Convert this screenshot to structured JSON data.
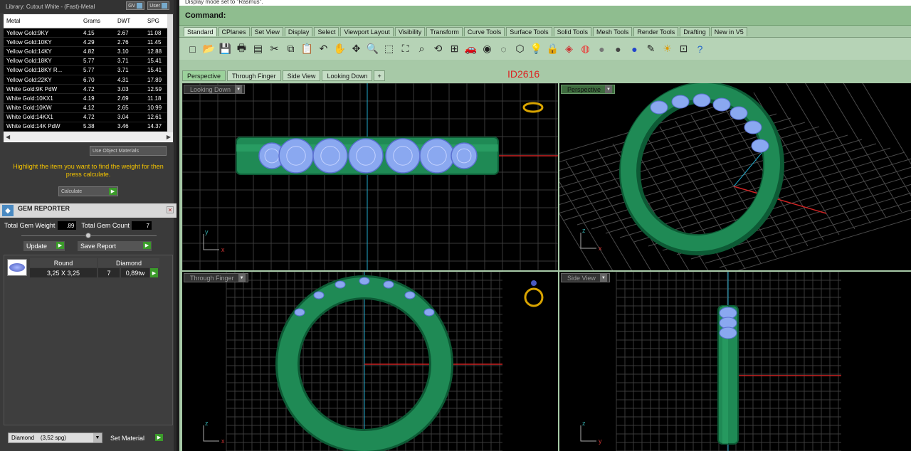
{
  "library": {
    "title": "Library: Cutout White - (Fast)-Metal",
    "gv_label": "GV",
    "user_label": "User",
    "columns": [
      "Metal",
      "Grams",
      "DWT",
      "SPG"
    ],
    "rows": [
      [
        "Yellow Gold:9KY",
        "4.15",
        "2.67",
        "11.08"
      ],
      [
        "Yellow Gold:10KY",
        "4.29",
        "2.76",
        "11.45"
      ],
      [
        "Yellow Gold:14KY",
        "4.82",
        "3.10",
        "12.88"
      ],
      [
        "Yellow Gold:18KY",
        "5.77",
        "3.71",
        "15.41"
      ],
      [
        "Yellow Gold:18KY R...",
        "5.77",
        "3.71",
        "15.41"
      ],
      [
        "Yellow Gold:22KY",
        "6.70",
        "4.31",
        "17.89"
      ],
      [
        "White Gold:9K PdW",
        "4.72",
        "3.03",
        "12.59"
      ],
      [
        "White Gold:10KX1",
        "4.19",
        "2.69",
        "11.18"
      ],
      [
        "White Gold:10KW",
        "4.12",
        "2.65",
        "10.99"
      ],
      [
        "White Gold:14KX1",
        "4.72",
        "3.04",
        "12.61"
      ],
      [
        "White Gold:14K PdW",
        "5.38",
        "3.46",
        "14.37"
      ]
    ],
    "use_object_materials": "Use Object Materials",
    "hint": "Highlight the item you want to find the weight for then press calculate.",
    "calculate": "Calculate"
  },
  "gem_reporter": {
    "title": "GEM REPORTER",
    "total_weight_label": "Total Gem Weight",
    "total_weight": ".89",
    "total_count_label": "Total Gem Count",
    "total_count": "7",
    "update": "Update",
    "save_report": "Save Report",
    "gem": {
      "shape": "Round",
      "material": "Diamond",
      "size": "3,25 X 3,25",
      "count": "7",
      "weight": "0,89tw"
    },
    "material_dropdown": "Diamond    (3,52 spg)",
    "set_material": "Set Material"
  },
  "top": {
    "status": "Display mode set to \"Rasmus\".",
    "command": "Command:"
  },
  "tabs": [
    "Standard",
    "CPlanes",
    "Set View",
    "Display",
    "Select",
    "Viewport Layout",
    "Visibility",
    "Transform",
    "Curve Tools",
    "Surface Tools",
    "Solid Tools",
    "Mesh Tools",
    "Render Tools",
    "Drafting",
    "New in V5"
  ],
  "tools": [
    "new-icon",
    "open-icon",
    "save-icon",
    "print-icon",
    "page-icon",
    "cut-icon",
    "copy-icon",
    "paste-icon",
    "undo-icon",
    "pan-icon",
    "move-icon",
    "zoom-icon",
    "zoom-window-icon",
    "zoom-extents-icon",
    "zoom-selected-icon",
    "rotate-view-icon",
    "grid-icon",
    "car-icon",
    "point-icon",
    "circle-icon",
    "select-icon",
    "light-icon",
    "lock-icon",
    "material-icon",
    "color-wheel-icon",
    "sphere-gray-icon",
    "sphere-shaded-icon",
    "sphere-blue-icon",
    "render-icon",
    "sun-icon",
    "dimension-icon",
    "help-icon"
  ],
  "tool_glyphs": [
    "□",
    "📂",
    "💾",
    "🖶",
    "▤",
    "✂",
    "⧉",
    "📋",
    "↶",
    "✋",
    "✥",
    "🔍",
    "⬚",
    "⛶",
    "⌕",
    "⟲",
    "⊞",
    "🚗",
    "◉",
    "◌",
    "⬡",
    "💡",
    "🔒",
    "◈",
    "◍",
    "●",
    "●",
    "●",
    "✎",
    "☀",
    "⊡",
    "?"
  ],
  "viewport_tabs": [
    "Perspective",
    "Through Finger",
    "Side View",
    "Looking Down"
  ],
  "id_label": "ID2616",
  "viewports": {
    "top_left": "Looking Down",
    "top_right": "Perspective",
    "bottom_left": "Through Finger",
    "bottom_right": "Side View"
  },
  "colors": {
    "ring_green": "#1f8a55",
    "gem_blue": "#8aa8f0",
    "grid": "#555555",
    "axis_x": "#cc2222",
    "axis_y": "#22aacc"
  }
}
